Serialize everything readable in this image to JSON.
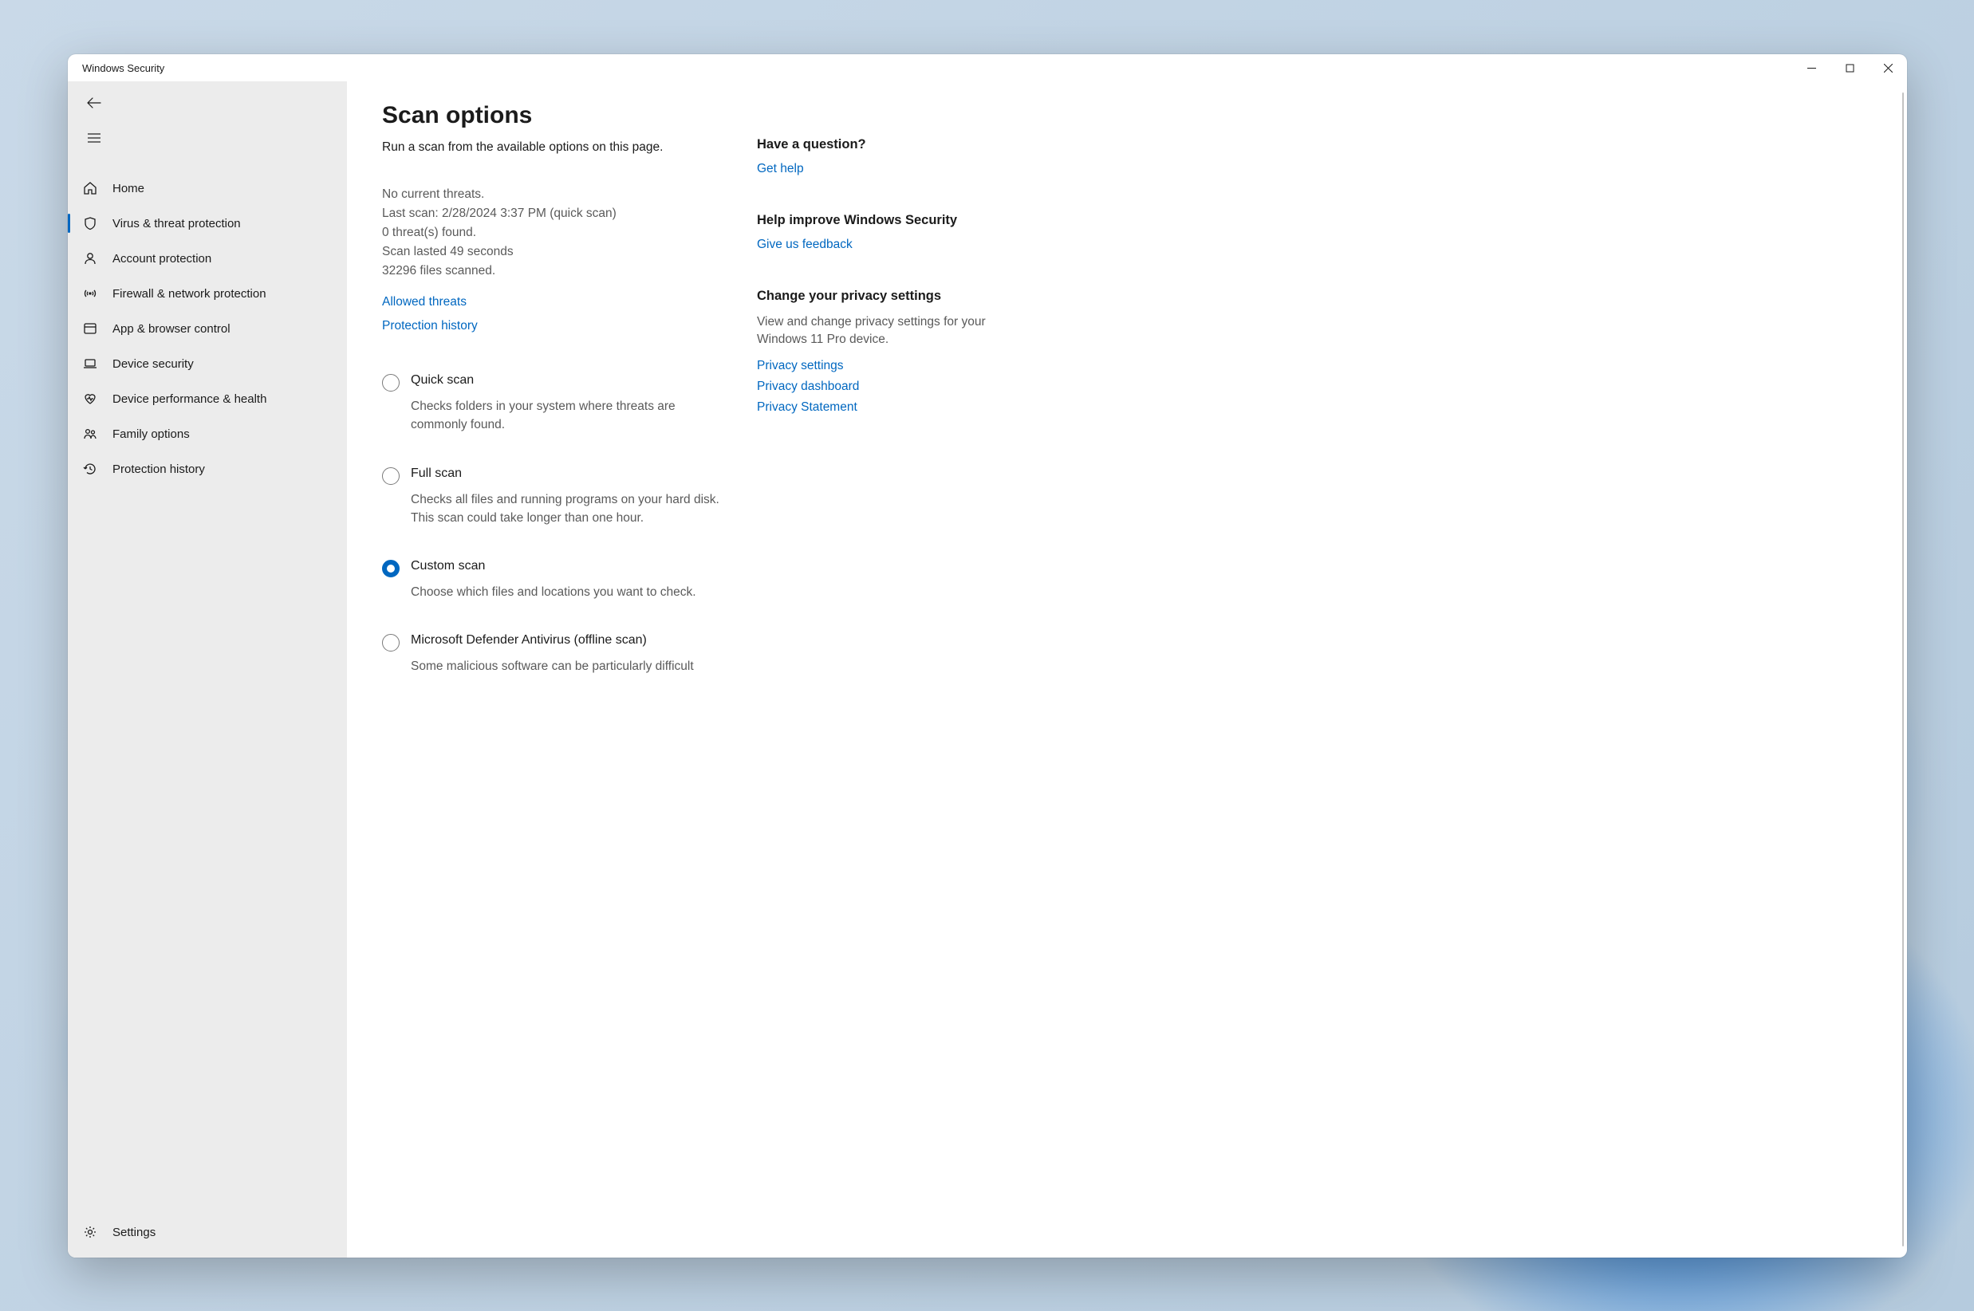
{
  "window": {
    "title": "Windows Security"
  },
  "sidebar": {
    "items": [
      {
        "label": "Home",
        "selected": false
      },
      {
        "label": "Virus & threat protection",
        "selected": true
      },
      {
        "label": "Account protection",
        "selected": false
      },
      {
        "label": "Firewall & network protection",
        "selected": false
      },
      {
        "label": "App & browser control",
        "selected": false
      },
      {
        "label": "Device security",
        "selected": false
      },
      {
        "label": "Device performance & health",
        "selected": false
      },
      {
        "label": "Family options",
        "selected": false
      },
      {
        "label": "Protection history",
        "selected": false
      }
    ],
    "settings_label": "Settings"
  },
  "main": {
    "title": "Scan options",
    "subtitle": "Run a scan from the available options on this page.",
    "status": {
      "no_threats": "No current threats.",
      "last_scan": "Last scan: 2/28/2024 3:37 PM (quick scan)",
      "threats_found": "0 threat(s) found.",
      "duration": "Scan lasted 49 seconds",
      "files_scanned": "32296 files scanned."
    },
    "links": {
      "allowed_threats": "Allowed threats",
      "protection_history": "Protection history"
    },
    "options": [
      {
        "label": "Quick scan",
        "desc": "Checks folders in your system where threats are commonly found.",
        "selected": false
      },
      {
        "label": "Full scan",
        "desc": "Checks all files and running programs on your hard disk. This scan could take longer than one hour.",
        "selected": false
      },
      {
        "label": "Custom scan",
        "desc": "Choose which files and locations you want to check.",
        "selected": true
      },
      {
        "label": "Microsoft Defender Antivirus (offline scan)",
        "desc": "Some malicious software can be particularly difficult",
        "selected": false
      }
    ]
  },
  "aside": {
    "question": {
      "title": "Have a question?",
      "link": "Get help"
    },
    "improve": {
      "title": "Help improve Windows Security",
      "link": "Give us feedback"
    },
    "privacy": {
      "title": "Change your privacy settings",
      "text": "View and change privacy settings for your Windows 11 Pro device.",
      "links": [
        "Privacy settings",
        "Privacy dashboard",
        "Privacy Statement"
      ]
    }
  }
}
